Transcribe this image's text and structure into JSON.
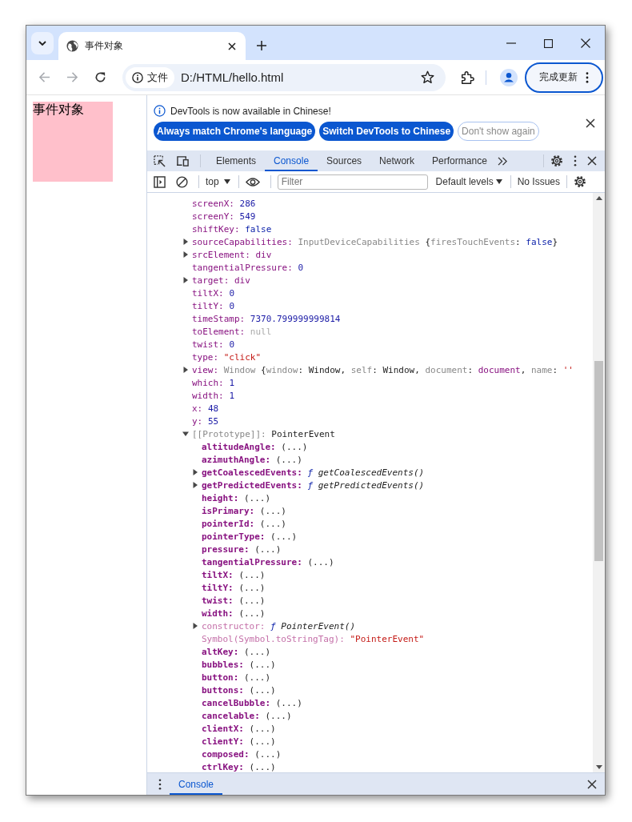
{
  "browser": {
    "tabs": [
      {
        "title": "事件对象",
        "selected": true
      }
    ],
    "address": {
      "chip": "文件",
      "url": "D:/HTML/hello.html"
    },
    "update_button": "完成更新"
  },
  "page": {
    "box_text": "事件对象"
  },
  "infobar": {
    "message": "DevTools is now available in Chinese!",
    "buttons": [
      {
        "label": "Always match Chrome's language",
        "kind": "primary"
      },
      {
        "label": "Switch DevTools to Chinese",
        "kind": "primary"
      },
      {
        "label": "Don't show again",
        "kind": "secondary"
      }
    ]
  },
  "devtools_tabs": [
    {
      "label": "Elements",
      "selected": false
    },
    {
      "label": "Console",
      "selected": true
    },
    {
      "label": "Sources",
      "selected": false
    },
    {
      "label": "Network",
      "selected": false
    },
    {
      "label": "Performance",
      "selected": false
    }
  ],
  "console_toolbar": {
    "context": "top",
    "filter_placeholder": "Filter",
    "levels": "Default levels",
    "issues": "No Issues"
  },
  "console_lines": [
    {
      "key": "screenX:",
      "kind": "own",
      "value": [
        {
          "t": "286",
          "kind": "number"
        }
      ]
    },
    {
      "key": "screenY:",
      "kind": "own",
      "value": [
        {
          "t": "549",
          "kind": "number"
        }
      ]
    },
    {
      "key": "shiftKey:",
      "kind": "own",
      "value": [
        {
          "t": "false",
          "kind": "keyword"
        }
      ]
    },
    {
      "key": "sourceCapabilities:",
      "kind": "own",
      "expandable": true,
      "expanded": false,
      "value": [
        {
          "t": "InputDeviceCapabilities ",
          "kind": "class"
        },
        {
          "t": "{",
          "kind": "plain"
        },
        {
          "t": "firesTouchEvents",
          "kind": "subkey"
        },
        {
          "t": ": ",
          "kind": "plain"
        },
        {
          "t": "false",
          "kind": "keyword"
        },
        {
          "t": "}",
          "kind": "plain"
        }
      ]
    },
    {
      "key": "srcElement:",
      "kind": "own",
      "expandable": true,
      "expanded": false,
      "value": [
        {
          "t": "div",
          "kind": "node"
        }
      ]
    },
    {
      "key": "tangentialPressure:",
      "kind": "own",
      "value": [
        {
          "t": "0",
          "kind": "number"
        }
      ]
    },
    {
      "key": "target:",
      "kind": "own",
      "expandable": true,
      "expanded": false,
      "value": [
        {
          "t": "div",
          "kind": "node"
        }
      ]
    },
    {
      "key": "tiltX:",
      "kind": "own",
      "value": [
        {
          "t": "0",
          "kind": "number"
        }
      ]
    },
    {
      "key": "tiltY:",
      "kind": "own",
      "value": [
        {
          "t": "0",
          "kind": "number"
        }
      ]
    },
    {
      "key": "timeStamp:",
      "kind": "own",
      "value": [
        {
          "t": "7370.799999999814",
          "kind": "number"
        }
      ]
    },
    {
      "key": "toElement:",
      "kind": "own",
      "value": [
        {
          "t": "null",
          "kind": "null"
        }
      ]
    },
    {
      "key": "twist:",
      "kind": "own",
      "value": [
        {
          "t": "0",
          "kind": "number"
        }
      ]
    },
    {
      "key": "type:",
      "kind": "own",
      "value": [
        {
          "t": "\"click\"",
          "kind": "string"
        }
      ]
    },
    {
      "key": "view:",
      "kind": "own",
      "expandable": true,
      "expanded": false,
      "value": [
        {
          "t": "Window ",
          "kind": "class"
        },
        {
          "t": "{",
          "kind": "plain"
        },
        {
          "t": "window",
          "kind": "subkey"
        },
        {
          "t": ": ",
          "kind": "plain"
        },
        {
          "t": "Window",
          "kind": "plain"
        },
        {
          "t": ", ",
          "kind": "plain"
        },
        {
          "t": "self",
          "kind": "subkey"
        },
        {
          "t": ": ",
          "kind": "plain"
        },
        {
          "t": "Window",
          "kind": "plain"
        },
        {
          "t": ", ",
          "kind": "plain"
        },
        {
          "t": "document",
          "kind": "subkey"
        },
        {
          "t": ": ",
          "kind": "plain"
        },
        {
          "t": "document",
          "kind": "node"
        },
        {
          "t": ", ",
          "kind": "plain"
        },
        {
          "t": "name",
          "kind": "subkey"
        },
        {
          "t": ": ",
          "kind": "plain"
        },
        {
          "t": "''",
          "kind": "string"
        }
      ]
    },
    {
      "key": "which:",
      "kind": "own",
      "value": [
        {
          "t": "1",
          "kind": "number"
        }
      ]
    },
    {
      "key": "width:",
      "kind": "own",
      "value": [
        {
          "t": "1",
          "kind": "number"
        }
      ]
    },
    {
      "key": "x:",
      "kind": "own",
      "value": [
        {
          "t": "48",
          "kind": "number"
        }
      ]
    },
    {
      "key": "y:",
      "kind": "own",
      "value": [
        {
          "t": "55",
          "kind": "number"
        }
      ]
    },
    {
      "key": "[[Prototype]]:",
      "kind": "internal",
      "expandable": true,
      "expanded": true,
      "value": [
        {
          "t": "PointerEvent",
          "kind": "plain"
        }
      ],
      "children": [
        {
          "key": "altitudeAngle:",
          "kind": "accessor",
          "value": [
            {
              "t": "(...)",
              "kind": "plain"
            }
          ]
        },
        {
          "key": "azimuthAngle:",
          "kind": "accessor",
          "value": [
            {
              "t": "(...)",
              "kind": "plain"
            }
          ]
        },
        {
          "key": "getCoalescedEvents:",
          "kind": "accessor",
          "expandable": true,
          "expanded": false,
          "value": [
            {
              "t": "ƒ ",
              "kind": "fn-mark"
            },
            {
              "t": "getCoalescedEvents()",
              "kind": "fn"
            }
          ]
        },
        {
          "key": "getPredictedEvents:",
          "kind": "accessor",
          "expandable": true,
          "expanded": false,
          "value": [
            {
              "t": "ƒ ",
              "kind": "fn-mark"
            },
            {
              "t": "getPredictedEvents()",
              "kind": "fn"
            }
          ]
        },
        {
          "key": "height:",
          "kind": "accessor",
          "value": [
            {
              "t": "(...)",
              "kind": "plain"
            }
          ]
        },
        {
          "key": "isPrimary:",
          "kind": "accessor",
          "value": [
            {
              "t": "(...)",
              "kind": "plain"
            }
          ]
        },
        {
          "key": "pointerId:",
          "kind": "accessor",
          "value": [
            {
              "t": "(...)",
              "kind": "plain"
            }
          ]
        },
        {
          "key": "pointerType:",
          "kind": "accessor",
          "value": [
            {
              "t": "(...)",
              "kind": "plain"
            }
          ]
        },
        {
          "key": "pressure:",
          "kind": "accessor",
          "value": [
            {
              "t": "(...)",
              "kind": "plain"
            }
          ]
        },
        {
          "key": "tangentialPressure:",
          "kind": "accessor",
          "value": [
            {
              "t": "(...)",
              "kind": "plain"
            }
          ]
        },
        {
          "key": "tiltX:",
          "kind": "accessor",
          "value": [
            {
              "t": "(...)",
              "kind": "plain"
            }
          ]
        },
        {
          "key": "tiltY:",
          "kind": "accessor",
          "value": [
            {
              "t": "(...)",
              "kind": "plain"
            }
          ]
        },
        {
          "key": "twist:",
          "kind": "accessor",
          "value": [
            {
              "t": "(...)",
              "kind": "plain"
            }
          ]
        },
        {
          "key": "width:",
          "kind": "accessor",
          "value": [
            {
              "t": "(...)",
              "kind": "plain"
            }
          ]
        },
        {
          "key": "constructor:",
          "kind": "nonenum",
          "expandable": true,
          "expanded": false,
          "value": [
            {
              "t": "ƒ ",
              "kind": "fn-mark"
            },
            {
              "t": "PointerEvent()",
              "kind": "fn"
            }
          ]
        },
        {
          "key": "Symbol(Symbol.toStringTag):",
          "kind": "nonenum",
          "value": [
            {
              "t": "\"PointerEvent\"",
              "kind": "string"
            }
          ]
        },
        {
          "key": "altKey:",
          "kind": "accessor",
          "value": [
            {
              "t": "(...)",
              "kind": "plain"
            }
          ]
        },
        {
          "key": "bubbles:",
          "kind": "accessor",
          "value": [
            {
              "t": "(...)",
              "kind": "plain"
            }
          ]
        },
        {
          "key": "button:",
          "kind": "accessor",
          "value": [
            {
              "t": "(...)",
              "kind": "plain"
            }
          ]
        },
        {
          "key": "buttons:",
          "kind": "accessor",
          "value": [
            {
              "t": "(...)",
              "kind": "plain"
            }
          ]
        },
        {
          "key": "cancelBubble:",
          "kind": "accessor",
          "value": [
            {
              "t": "(...)",
              "kind": "plain"
            }
          ]
        },
        {
          "key": "cancelable:",
          "kind": "accessor",
          "value": [
            {
              "t": "(...)",
              "kind": "plain"
            }
          ]
        },
        {
          "key": "clientX:",
          "kind": "accessor",
          "value": [
            {
              "t": "(...)",
              "kind": "plain"
            }
          ]
        },
        {
          "key": "clientY:",
          "kind": "accessor",
          "value": [
            {
              "t": "(...)",
              "kind": "plain"
            }
          ]
        },
        {
          "key": "composed:",
          "kind": "accessor",
          "value": [
            {
              "t": "(...)",
              "kind": "plain"
            }
          ]
        },
        {
          "key": "ctrlKey:",
          "kind": "accessor",
          "value": [
            {
              "t": "(...)",
              "kind": "plain"
            }
          ]
        }
      ]
    }
  ],
  "drawer_tabs": [
    {
      "label": "Console",
      "selected": true
    }
  ]
}
